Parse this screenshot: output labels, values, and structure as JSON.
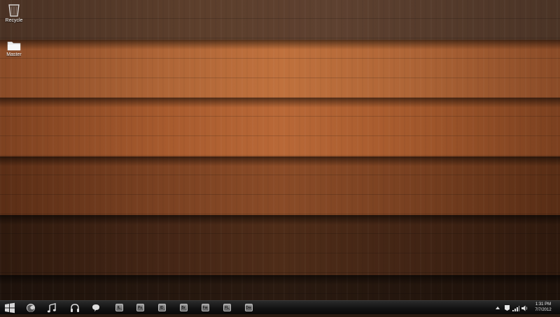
{
  "desktop": {
    "icons": [
      {
        "label": "Recycle",
        "icon": "recycle-bin-icon"
      },
      {
        "label": "Master",
        "icon": "folder-icon"
      }
    ]
  },
  "taskbar": {
    "start_icon": "windows-logo-icon",
    "pinned_apps": [
      {
        "icon": "firefox-icon"
      },
      {
        "icon": "music-note-icon"
      },
      {
        "icon": "headphones-icon"
      },
      {
        "icon": "chat-bubble-icon"
      },
      {
        "icon": "illustrator-icon",
        "label": "IL"
      },
      {
        "icon": "photoshop-icon",
        "label": "Ps"
      },
      {
        "icon": "indesign-icon",
        "label": "ID"
      },
      {
        "icon": "bridge-icon",
        "label": "Br"
      },
      {
        "icon": "fireworks-icon",
        "label": "Fw"
      },
      {
        "icon": "flash-icon",
        "label": "FL"
      },
      {
        "icon": "dreamweaver-icon",
        "label": "Dw"
      }
    ],
    "tray": {
      "icons": [
        "show-hidden-icons-arrow",
        "network-flag-icon",
        "signal-bars-icon",
        "volume-icon"
      ],
      "time": "1:31 PM",
      "date": "7/7/2012"
    }
  },
  "colors": {
    "wood_light": "#c0713d",
    "wood_dark": "#2a1a10",
    "taskbar": "#111111"
  }
}
